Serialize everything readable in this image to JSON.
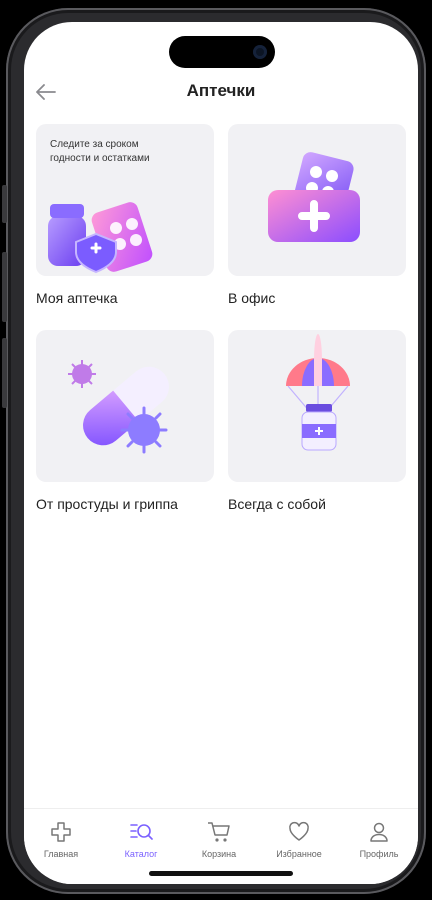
{
  "header": {
    "title": "Аптечки",
    "back_icon": "arrow-left-icon"
  },
  "cards": [
    {
      "label": "Моя аптечка",
      "promo": "Следите за сроком годности и остатками",
      "image": "medicine-bottle-shield-illustration"
    },
    {
      "label": "В офис",
      "image": "first-aid-kit-illustration"
    },
    {
      "label": "От простуды и гриппа",
      "image": "capsule-virus-illustration"
    },
    {
      "label": "Всегда с собой",
      "image": "parachute-bottle-illustration"
    }
  ],
  "tabbar": {
    "items": [
      {
        "label": "Главная",
        "icon": "plus-cross-icon",
        "active": false
      },
      {
        "label": "Каталог",
        "icon": "catalog-search-icon",
        "active": true
      },
      {
        "label": "Корзина",
        "icon": "cart-icon",
        "active": false
      },
      {
        "label": "Избранное",
        "icon": "heart-icon",
        "active": false
      },
      {
        "label": "Профиль",
        "icon": "profile-icon",
        "active": false
      }
    ]
  },
  "colors": {
    "accent": "#7b61ff",
    "card_bg": "#f1f1f4",
    "text": "#222222"
  }
}
